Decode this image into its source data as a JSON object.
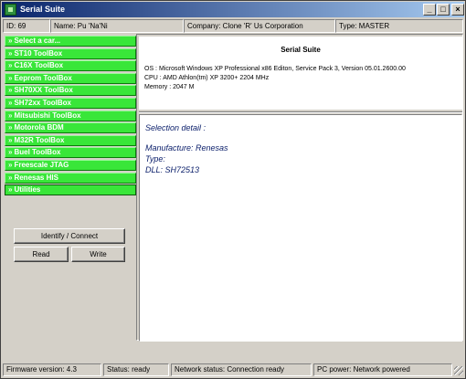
{
  "window": {
    "title": "Serial Suite",
    "controls": [
      "_",
      "□",
      "×"
    ]
  },
  "info_bar": {
    "id": "ID: 69",
    "name": "Name: Pu 'Na'Ni",
    "company": "Company: Clone 'R' Us Corporation",
    "type": "Type: MASTER"
  },
  "sidebar": {
    "arrow": "»",
    "items": [
      {
        "label": "Select a car..."
      },
      {
        "label": "ST10 ToolBox"
      },
      {
        "label": "C16X ToolBox"
      },
      {
        "label": "Eeprom ToolBox"
      },
      {
        "label": "SH70XX ToolBox"
      },
      {
        "label": "SH72xx ToolBox"
      },
      {
        "label": "Mitsubishi ToolBox"
      },
      {
        "label": "Motorola BDM"
      },
      {
        "label": "M32R ToolBox"
      },
      {
        "label": "Buel ToolBox"
      },
      {
        "label": "Freescale JTAG"
      },
      {
        "label": "Renesas HIS"
      },
      {
        "label": "Utilities"
      }
    ],
    "selected_index": 12,
    "accent_color": "#39e639"
  },
  "actions": {
    "identify": "Identify / Connect",
    "read": "Read",
    "write": "Write"
  },
  "system_info": {
    "title": "Serial Suite",
    "os": "OS : Microsoft Windows XP Professional x86 Editon, Service Pack 3, Version 05.01.2600.00",
    "cpu": "CPU : AMD Athlon(tm) XP 3200+ 2204 MHz",
    "memory": "Memory : 2047 M"
  },
  "selection_detail": {
    "heading": "Selection detail :",
    "manufacture": "Manufacture: Renesas",
    "type": "Type:",
    "dll": "DLL: SH72513",
    "text_color": "#0a1e6a"
  },
  "status_bar": {
    "firmware": "Firmware version: 4.3",
    "status": "Status: ready",
    "network": "Network status: Connection ready",
    "power": "PC power: Network powered"
  }
}
